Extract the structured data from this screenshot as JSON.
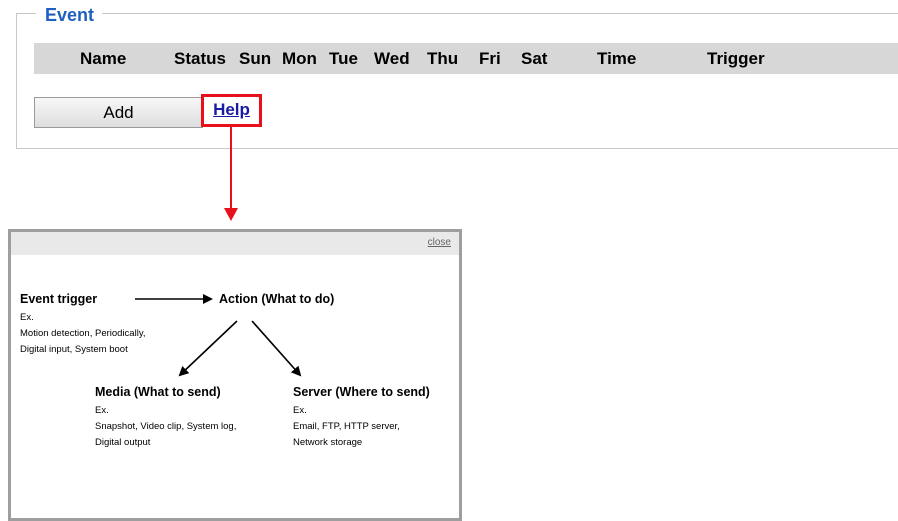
{
  "event": {
    "legend": "Event",
    "columns": [
      "Name",
      "Status",
      "Sun",
      "Mon",
      "Tue",
      "Wed",
      "Thu",
      "Fri",
      "Sat",
      "Time",
      "Trigger"
    ],
    "add_label": "Add",
    "help_label": "Help"
  },
  "popup": {
    "close_label": "close",
    "trigger": {
      "title": "Event trigger",
      "lines": [
        "Ex.",
        "Motion detection, Periodically,",
        "Digital input, System boot"
      ]
    },
    "action": {
      "title": "Action (What to do)"
    },
    "media": {
      "title": "Media (What to send)",
      "lines": [
        "Ex.",
        "Snapshot, Video clip, System log,",
        "Digital output"
      ]
    },
    "server": {
      "title": "Server (Where to send)",
      "lines": [
        "Ex.",
        "Email, FTP, HTTP server,",
        "Network storage"
      ]
    }
  },
  "colors": {
    "legend": "#1f5fbf",
    "header_bar": "#d7d7d7",
    "highlight": "#e8101a",
    "link": "#1a1aa6"
  }
}
